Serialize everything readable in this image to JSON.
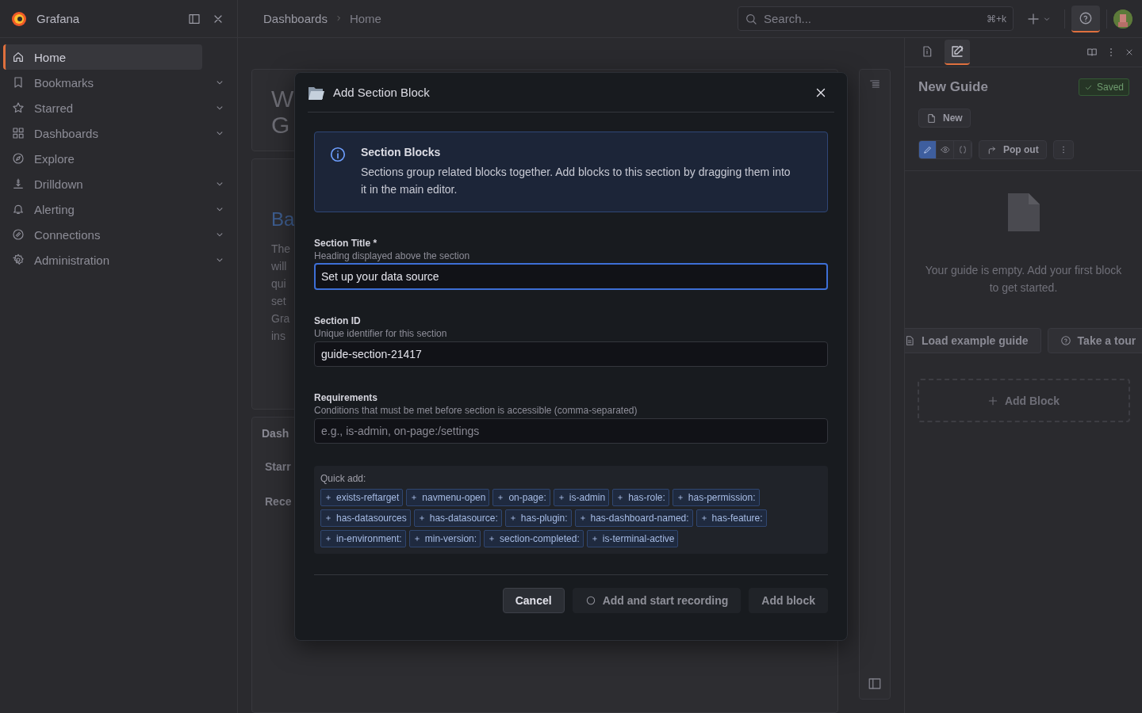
{
  "app": {
    "name": "Grafana"
  },
  "breadcrumbs": [
    "Dashboards",
    "Home"
  ],
  "search": {
    "placeholder": "Search...",
    "shortcut": "⌘+k"
  },
  "help_button": {
    "selected": true
  },
  "sidebar": {
    "items": [
      {
        "label": "Home",
        "selected": true,
        "expandable": false
      },
      {
        "label": "Bookmarks",
        "selected": false,
        "expandable": true
      },
      {
        "label": "Starred",
        "selected": false,
        "expandable": true
      },
      {
        "label": "Dashboards",
        "selected": false,
        "expandable": true
      },
      {
        "label": "Explore",
        "selected": false,
        "expandable": false
      },
      {
        "label": "Drilldown",
        "selected": false,
        "expandable": true
      },
      {
        "label": "Alerting",
        "selected": false,
        "expandable": true
      },
      {
        "label": "Connections",
        "selected": false,
        "expandable": true
      },
      {
        "label": "Administration",
        "selected": false,
        "expandable": true
      }
    ]
  },
  "background_cards": [
    {
      "kind": "title",
      "lines": [
        "W",
        "G"
      ]
    },
    {
      "kind": "text",
      "heading": "Ba",
      "lines": [
        "The",
        "will",
        "qui",
        "set",
        "Gra",
        "ins"
      ]
    },
    {
      "kind": "list",
      "heading": "Dash",
      "lines": [
        "Starr",
        "Rece"
      ]
    }
  ],
  "modal": {
    "title": "Add Section Block",
    "info": {
      "title": "Section Blocks",
      "text": "Sections group related blocks together. Add blocks to this section by dragging them into it in the main editor."
    },
    "fields": [
      {
        "label": "Section Title *",
        "hint": "Heading displayed above the section",
        "value": "Set up your data source",
        "focused": true
      },
      {
        "label": "Section ID",
        "hint": "Unique identifier for this section",
        "value": "guide-section-21417",
        "focused": false
      },
      {
        "label": "Requirements",
        "hint": "Conditions that must be met before section is accessible (comma-separated)",
        "placeholder": "e.g., is-admin, on-page:/settings",
        "focused": false
      }
    ],
    "quick_add": {
      "label": "Quick add:",
      "chips": [
        "exists-reftarget",
        "navmenu-open",
        "on-page:",
        "is-admin",
        "has-role:",
        "has-permission:",
        "has-datasources",
        "has-datasource:",
        "has-plugin:",
        "has-dashboard-named:",
        "has-feature:",
        "in-environment:",
        "min-version:",
        "section-completed:",
        "is-terminal-active"
      ]
    },
    "buttons": [
      {
        "label": "Cancel",
        "kind": "secondary"
      },
      {
        "label": "Add and start recording",
        "kind": "record"
      },
      {
        "label": "Add block",
        "kind": "primary"
      }
    ]
  },
  "guide_panel": {
    "tabs": [
      {
        "kind": "info",
        "selected": false
      },
      {
        "kind": "edit",
        "selected": true
      }
    ],
    "title": "New Guide",
    "status": "Saved",
    "new_button": "New",
    "view_modes": [
      {
        "kind": "edit",
        "selected": true
      },
      {
        "kind": "preview",
        "selected": false
      },
      {
        "kind": "code",
        "selected": false
      }
    ],
    "pop_out": "Pop out",
    "empty_text": "Your guide is empty. Add your first block to get started.",
    "actions": [
      {
        "label": "Load example guide",
        "kind": "doc"
      },
      {
        "label": "Take a tour",
        "kind": "help"
      }
    ],
    "add_block": "Add Block"
  }
}
